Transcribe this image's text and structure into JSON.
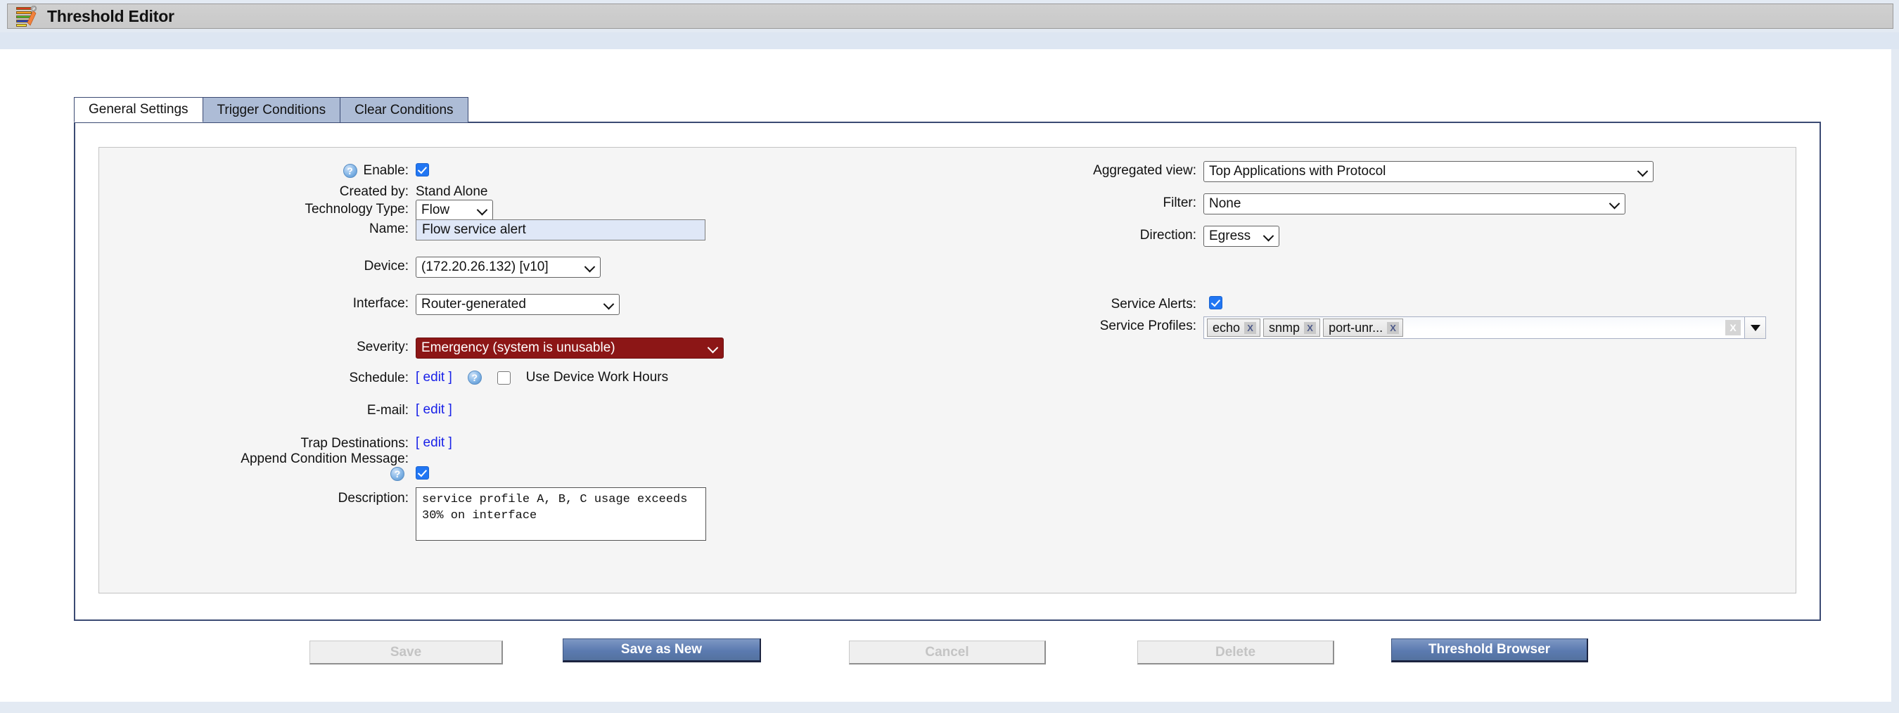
{
  "window": {
    "title": "Threshold Editor",
    "icon": "threshold-wrench-icon"
  },
  "tabs": [
    {
      "label": "General Settings",
      "active": true
    },
    {
      "label": "Trigger Conditions",
      "active": false
    },
    {
      "label": "Clear Conditions",
      "active": false
    }
  ],
  "left_column": {
    "enable": {
      "label": "Enable:",
      "checked": true,
      "help": "?"
    },
    "created_by": {
      "label": "Created by:",
      "value": "Stand Alone"
    },
    "technology_type": {
      "label": "Technology Type:",
      "value": "Flow"
    },
    "name": {
      "label": "Name:",
      "value": "Flow service alert"
    },
    "device": {
      "label": "Device:",
      "value": "(172.20.26.132) [v10]"
    },
    "interface": {
      "label": "Interface:",
      "value": "Router-generated"
    },
    "severity": {
      "label": "Severity:",
      "value": "Emergency (system is unusable)",
      "color": "#8c1616"
    },
    "schedule": {
      "label": "Schedule:",
      "edit": "[ edit ]",
      "help": "?",
      "work_hours_label": "Use Device Work Hours",
      "work_hours_checked": false
    },
    "email": {
      "label": "E-mail:",
      "edit": "[ edit ]"
    },
    "trap_destinations": {
      "label": "Trap Destinations:",
      "edit": "[ edit ]"
    },
    "append_condition_message": {
      "label": "Append Condition Message:",
      "checked": true,
      "help": "?"
    },
    "description": {
      "label": "Description:",
      "value": "service profile A, B, C usage exceeds 30% on interface"
    }
  },
  "right_column": {
    "aggregated_view": {
      "label": "Aggregated view:",
      "value": "Top Applications with Protocol"
    },
    "filter": {
      "label": "Filter:",
      "value": "None"
    },
    "direction": {
      "label": "Direction:",
      "value": "Egress"
    },
    "service_alerts": {
      "label": "Service Alerts:",
      "checked": true
    },
    "service_profiles": {
      "label": "Service Profiles:",
      "chips": [
        {
          "text": "echo",
          "remove": "X"
        },
        {
          "text": "snmp",
          "remove": "X"
        },
        {
          "text": "port-unr...",
          "remove": "X"
        }
      ],
      "clear_all": "X"
    }
  },
  "footer": {
    "save": {
      "label": "Save",
      "enabled": false
    },
    "save_as_new": {
      "label": "Save as New",
      "enabled": true
    },
    "cancel": {
      "label": "Cancel",
      "enabled": false
    },
    "delete": {
      "label": "Delete",
      "enabled": false
    },
    "threshold_browser": {
      "label": "Threshold Browser",
      "enabled": true
    }
  }
}
